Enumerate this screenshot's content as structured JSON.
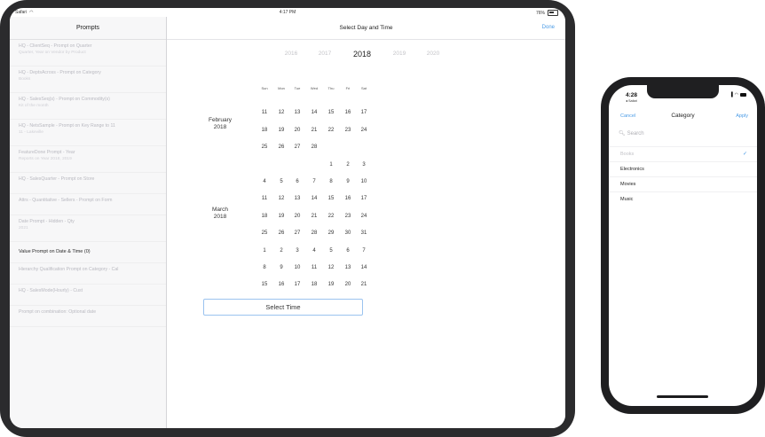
{
  "ipad": {
    "status": {
      "left": "Safari",
      "time": "4:17 PM",
      "battery": "76%"
    },
    "sidebar": {
      "title": "Prompts",
      "items": [
        {
          "label": "HQ - ClientSeq - Prompt on Quarter",
          "sub": "Quarter, Year on Vendor by Product",
          "tall": true
        },
        {
          "label": "HQ - DeptsAcross - Prompt on Category",
          "sub": "Books",
          "tall": true
        },
        {
          "label": "HQ - SalesSeq(s) - Prompt on Commodity(s)",
          "sub": "Kit of the month",
          "tall": true
        },
        {
          "label": "HQ - NetsSample - Prompt on Key Range to 11",
          "sub": "11 - Lakeville",
          "tall": true
        },
        {
          "label": "FeatureDone Prompt - Year",
          "sub": "Reports on Year 2018, 2019",
          "tall": true
        },
        {
          "label": "HQ - SalesQuarter - Prompt on Store",
          "sub": "",
          "tall": false
        },
        {
          "label": "Attrs - Quantitative - Sellers - Prompt on Form",
          "sub": "",
          "tall": false
        },
        {
          "label": "Date Prompt - Hidden - Qty",
          "sub": "2021",
          "tall": true
        },
        {
          "label": "Value Prompt on Date & Time (0)",
          "sub": "",
          "tall": false,
          "active": true
        },
        {
          "label": "Hierarchy Qualification Prompt on Category - Cal",
          "sub": "",
          "tall": false
        },
        {
          "label": "HQ - SalesMode(Hourly) - Cust",
          "sub": "",
          "tall": false
        },
        {
          "label": "Prompt on combination: Optional date",
          "sub": "",
          "tall": false
        }
      ]
    },
    "content": {
      "title": "Select Day and Time",
      "done_label": "Done",
      "years": [
        "2016",
        "2017",
        "2018",
        "2019",
        "2020"
      ],
      "selected_year": "2018",
      "weekdays": [
        "Sun",
        "Mon",
        "Tue",
        "Wed",
        "Thu",
        "Fri",
        "Sat"
      ],
      "months": [
        {
          "label_line1": "February",
          "label_line2": "2018",
          "label_row": 2
        },
        {
          "label_line1": "March",
          "label_line2": "2018",
          "label_row": 8
        }
      ],
      "calendar_rows": [
        [
          "",
          "",
          "",
          "",
          "",
          "",
          ""
        ],
        [
          "11",
          "12",
          "13",
          "14",
          "15",
          "16",
          "17"
        ],
        [
          "18",
          "19",
          "20",
          "21",
          "22",
          "23",
          "24"
        ],
        [
          "25",
          "26",
          "27",
          "28",
          "",
          "",
          ""
        ],
        [
          "",
          "",
          "",
          "",
          "1",
          "2",
          "3"
        ],
        [
          "4",
          "5",
          "6",
          "7",
          "8",
          "9",
          "10"
        ],
        [
          "11",
          "12",
          "13",
          "14",
          "15",
          "16",
          "17"
        ],
        [
          "18",
          "19",
          "20",
          "21",
          "22",
          "23",
          "24"
        ],
        [
          "25",
          "26",
          "27",
          "28",
          "29",
          "30",
          "31"
        ],
        [
          "1",
          "2",
          "3",
          "4",
          "5",
          "6",
          "7"
        ],
        [
          "8",
          "9",
          "10",
          "11",
          "12",
          "13",
          "14"
        ],
        [
          "15",
          "16",
          "17",
          "18",
          "19",
          "20",
          "21"
        ]
      ],
      "select_time_label": "Select Time"
    }
  },
  "iphone": {
    "status": {
      "time": "4:28",
      "back": "◂ Safari"
    },
    "nav": {
      "cancel": "Cancel",
      "title": "Category",
      "apply": "Apply"
    },
    "search_placeholder": "Search",
    "items": [
      {
        "label": "Books",
        "selected": true
      },
      {
        "label": "Electronics",
        "selected": false
      },
      {
        "label": "Movies",
        "selected": false
      },
      {
        "label": "Music",
        "selected": false
      }
    ]
  }
}
